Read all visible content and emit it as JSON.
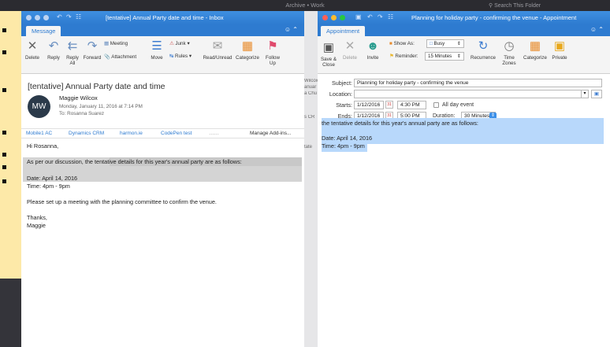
{
  "background": {
    "title": "Archive • Work",
    "search_placeholder": "Search This Folder",
    "gap_texts": [
      "Wilcox",
      "anuar",
      "a Chu",
      "s CR",
      "tate"
    ]
  },
  "email_window": {
    "title": "[tentative] Annual Party date and time - Inbox",
    "tab": "Message",
    "ribbon": {
      "delete": "Delete",
      "reply": "Reply",
      "reply_all": "Reply All",
      "forward": "Forward",
      "meeting": "Meeting",
      "attachment": "Attachment",
      "move": "Move",
      "junk": "Junk",
      "rules": "Rules",
      "read_unread": "Read/Unread",
      "categorize": "Categorize",
      "follow_up": "Follow Up"
    },
    "subject": "[tentative] Annual Party date and time",
    "avatar_initials": "MW",
    "sender": "Maggie Wilcox",
    "date": "Monday, January 11, 2016 at 7:14 PM",
    "to": "To:  Rosanna Suarez",
    "addins": [
      "Mobile1 AC",
      "Dynamics CRM",
      "harmon.ie",
      "CodePen test",
      "……"
    ],
    "manage_addins": "Manage Add-ins...",
    "body": {
      "greeting": "Hi Rosanna,",
      "line1_pre": "As per our discussion,",
      "line1_hl": " the tentative details for this year's annual party are as follows:",
      "date_line": "Date: April 14, 2016",
      "time_line": "Time: 4pm - 9pm",
      "request": "Please set up a meeting with the planning committee to confirm the venue.",
      "thanks": "Thanks,",
      "signoff": "Maggie"
    }
  },
  "appointment_window": {
    "title": "Planning for holiday party - confirming the venue - Appointment",
    "tab": "Appointment",
    "ribbon": {
      "save_close": "Save & Close",
      "delete": "Delete",
      "invite": "Invite",
      "show_as_label": "Show As:",
      "show_as_value": "Busy",
      "reminder_label": "Reminder:",
      "reminder_value": "15 Minutes",
      "recurrence": "Recurrence",
      "time_zones": "Time Zones",
      "categorize": "Categorize",
      "private": "Private"
    },
    "form": {
      "subject_label": "Subject:",
      "subject_value": "Planning for holiday party - confirming the venue",
      "location_label": "Location:",
      "location_value": "",
      "starts_label": "Starts:",
      "start_date": "1/12/2016",
      "start_time": "4:30 PM",
      "all_day": "All day event",
      "ends_label": "Ends:",
      "end_date": "1/12/2016",
      "end_time": "5:00 PM",
      "duration_label": "Duration:",
      "duration_value": "30 Minutes"
    },
    "body": {
      "line1": " the tentative details for this year's annual party are as follows:",
      "date_line": "Date: April 14, 2016",
      "time_line": "Time: 4pm - 9pm"
    }
  }
}
